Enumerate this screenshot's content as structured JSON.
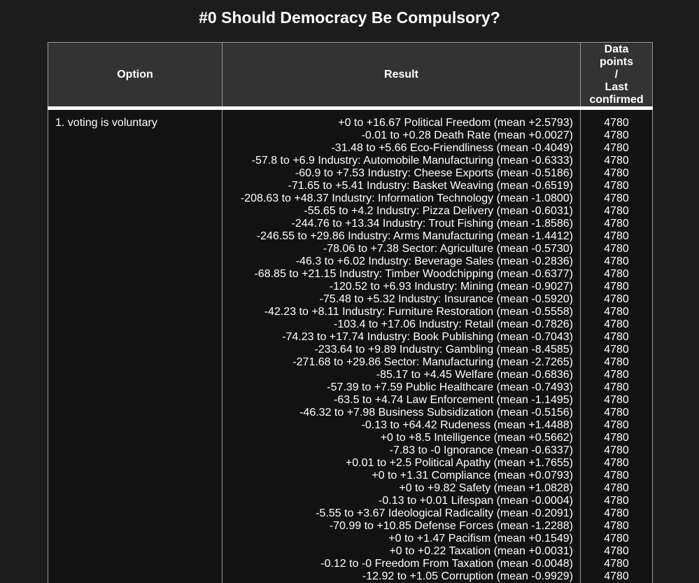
{
  "title": "#0 Should Democracy Be Compulsory?",
  "headers": {
    "option": "Option",
    "result": "Result",
    "data_points_line1": "Data",
    "data_points_line2": "points",
    "data_points_line3": "/",
    "data_points_line4": "Last",
    "data_points_line5": "confirmed"
  },
  "rows": [
    {
      "option": "1. voting is voluntary",
      "results": [
        "+0 to +16.67 Political Freedom (mean +2.5793)",
        "-0.01 to +0.28 Death Rate (mean +0.0027)",
        "-31.48 to +5.66 Eco-Friendliness (mean -0.4049)",
        "-57.8 to +6.9 Industry: Automobile Manufacturing (mean -0.6333)",
        "-60.9 to +7.53 Industry: Cheese Exports (mean -0.5186)",
        "-71.65 to +5.41 Industry: Basket Weaving (mean -0.6519)",
        "-208.63 to +48.37 Industry: Information Technology (mean -1.0800)",
        "-55.65 to +4.2 Industry: Pizza Delivery (mean -0.6031)",
        "-244.76 to +13.34 Industry: Trout Fishing (mean -1.8586)",
        "-246.55 to +29.86 Industry: Arms Manufacturing (mean -1.4412)",
        "-78.06 to +7.38 Sector: Agriculture (mean -0.5730)",
        "-46.3 to +6.02 Industry: Beverage Sales (mean -0.2836)",
        "-68.85 to +21.15 Industry: Timber Woodchipping (mean -0.6377)",
        "-120.52 to +6.93 Industry: Mining (mean -0.9027)",
        "-75.48 to +5.32 Industry: Insurance (mean -0.5920)",
        "-42.23 to +8.11 Industry: Furniture Restoration (mean -0.5558)",
        "-103.4 to +17.06 Industry: Retail (mean -0.7826)",
        "-74.23 to +17.74 Industry: Book Publishing (mean -0.7043)",
        "-233.64 to +9.89 Industry: Gambling (mean -8.4585)",
        "-271.68 to +29.86 Sector: Manufacturing (mean -2.7265)",
        "-85.17 to +4.45 Welfare (mean -0.6836)",
        "-57.39 to +7.59 Public Healthcare (mean -0.7493)",
        "-63.5 to +4.74 Law Enforcement (mean -1.1495)",
        "-46.32 to +7.98 Business Subsidization (mean -0.5156)",
        "-0.13 to +64.42 Rudeness (mean +1.4488)",
        "+0 to +8.5 Intelligence (mean +0.5662)",
        "-7.83 to -0 Ignorance (mean -0.6337)",
        "+0.01 to +2.5 Political Apathy (mean +1.7655)",
        "+0 to +1.31 Compliance (mean +0.0793)",
        "+0 to +9.82 Safety (mean +1.0828)",
        "-0.13 to +0.01 Lifespan (mean -0.0004)",
        "-5.55 to +3.67 Ideological Radicality (mean -0.2091)",
        "-70.99 to +10.85 Defense Forces (mean -1.2288)",
        "+0 to +1.47 Pacifism (mean +0.1549)",
        "+0 to +0.22 Taxation (mean +0.0031)",
        "-0.12 to -0 Freedom From Taxation (mean -0.0048)",
        "-12.92 to +1.05 Corruption (mean -0.9929)"
      ],
      "data_points": [
        "4780",
        "4780",
        "4780",
        "4780",
        "4780",
        "4780",
        "4780",
        "4780",
        "4780",
        "4780",
        "4780",
        "4780",
        "4780",
        "4780",
        "4780",
        "4780",
        "4780",
        "4780",
        "4780",
        "4780",
        "4780",
        "4780",
        "4780",
        "4780",
        "4780",
        "4780",
        "4780",
        "4780",
        "4780",
        "4780",
        "4780",
        "4780",
        "4780",
        "4780",
        "4780",
        "4780",
        "4780"
      ]
    }
  ]
}
